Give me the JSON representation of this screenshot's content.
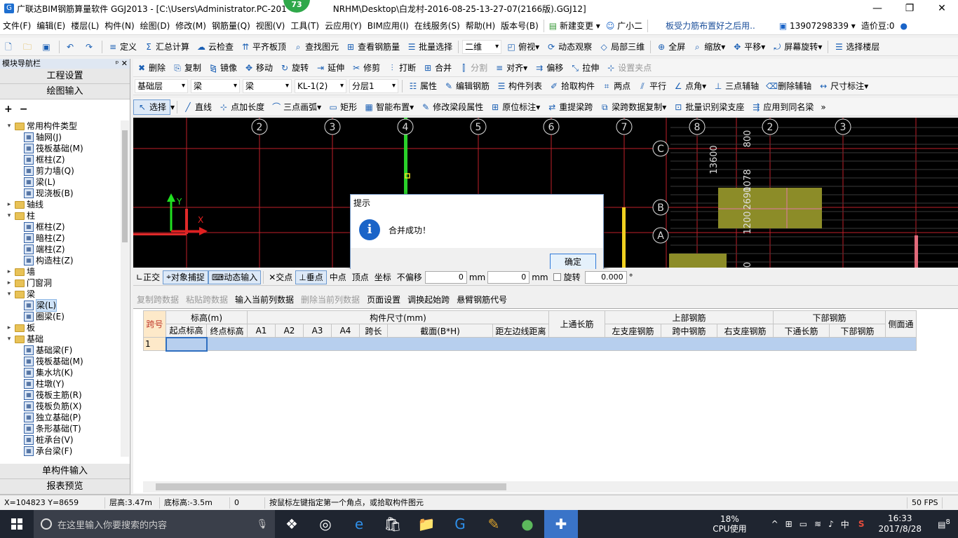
{
  "title": {
    "app": "广联达BIM钢筋算量软件 GGJ2013 - [C:\\Users\\Administrator.PC-201",
    "path": "NRHM\\Desktop\\白龙村-2016-08-25-13-27-07(2166版).GGJ12]",
    "badge": "73",
    "minimize": "—",
    "restore": "❐",
    "close": "✕"
  },
  "menu": {
    "items": [
      "文件(F)",
      "编辑(E)",
      "楼层(L)",
      "构件(N)",
      "绘图(D)",
      "修改(M)",
      "钢筋量(Q)",
      "视图(V)",
      "工具(T)",
      "云应用(Y)",
      "BIM应用(I)",
      "在线服务(S)",
      "帮助(H)",
      "版本号(B)"
    ],
    "new_change": "新建变更",
    "xiaoer": "广小二",
    "notice": "板受力筋布置好之后用..",
    "phone": "13907298339",
    "beans": "造价豆:0"
  },
  "toolbar1": {
    "items": [
      "定义",
      "汇总计算",
      "云检查",
      "平齐板顶",
      "查找图元",
      "查看钢筋量",
      "批量选择"
    ],
    "view2d": "二维",
    "view_top": "俯视",
    "dynamic": "动态观察",
    "local3d": "局部三维",
    "fullscreen": "全屏",
    "zoom": "缩放",
    "pan": "平移",
    "rotate": "屏幕旋转",
    "select_floor": "选择楼层"
  },
  "toolbar2": {
    "items": [
      "删除",
      "复制",
      "镜像",
      "移动",
      "旋转",
      "延伸",
      "修剪",
      "打断",
      "合并",
      "分割",
      "对齐",
      "偏移",
      "拉伸",
      "设置夹点"
    ]
  },
  "toolbar3": {
    "floor": "基础层",
    "type1": "梁",
    "type2": "梁",
    "component": "KL-1(2)",
    "layer": "分层1",
    "items": [
      "属性",
      "编辑钢筋",
      "构件列表",
      "拾取构件",
      "两点",
      "平行",
      "点角",
      "三点辅轴",
      "删除辅轴",
      "尺寸标注"
    ]
  },
  "toolbar4": {
    "select": "选择",
    "items": [
      "直线",
      "点加长度",
      "三点画弧",
      "矩形",
      "智能布置",
      "修改梁段属性",
      "原位标注",
      "重提梁跨",
      "梁跨数据复制",
      "批量识别梁支座",
      "应用到同名梁"
    ]
  },
  "leftpanel": {
    "title": "模块导航栏",
    "pin": "ᵖ",
    "close": "✕",
    "project_settings": "工程设置",
    "draw_input": "绘图输入",
    "single_input": "单构件输入",
    "report": "报表预览",
    "tree": [
      {
        "level": 0,
        "exp": "▾",
        "folder": true,
        "label": "常用构件类型"
      },
      {
        "level": 1,
        "label": "轴网(J)"
      },
      {
        "level": 1,
        "label": "筏板基础(M)"
      },
      {
        "level": 1,
        "label": "框柱(Z)"
      },
      {
        "level": 1,
        "label": "剪力墙(Q)"
      },
      {
        "level": 1,
        "label": "梁(L)"
      },
      {
        "level": 1,
        "label": "现浇板(B)"
      },
      {
        "level": 0,
        "exp": "▸",
        "folder": true,
        "label": "轴线"
      },
      {
        "level": 0,
        "exp": "▾",
        "folder": true,
        "label": "柱"
      },
      {
        "level": 1,
        "label": "框柱(Z)"
      },
      {
        "level": 1,
        "label": "暗柱(Z)"
      },
      {
        "level": 1,
        "label": "端柱(Z)"
      },
      {
        "level": 1,
        "label": "构造柱(Z)"
      },
      {
        "level": 0,
        "exp": "▸",
        "folder": true,
        "label": "墙"
      },
      {
        "level": 0,
        "exp": "▸",
        "folder": true,
        "label": "门窗洞"
      },
      {
        "level": 0,
        "exp": "▾",
        "folder": true,
        "label": "梁"
      },
      {
        "level": 1,
        "label": "梁(L)",
        "selected": true
      },
      {
        "level": 1,
        "label": "圈梁(E)"
      },
      {
        "level": 0,
        "exp": "▸",
        "folder": true,
        "label": "板"
      },
      {
        "level": 0,
        "exp": "▾",
        "folder": true,
        "label": "基础"
      },
      {
        "level": 1,
        "label": "基础梁(F)"
      },
      {
        "level": 1,
        "label": "筏板基础(M)"
      },
      {
        "level": 1,
        "label": "集水坑(K)"
      },
      {
        "level": 1,
        "label": "柱墩(Y)"
      },
      {
        "level": 1,
        "label": "筏板主筋(R)"
      },
      {
        "level": 1,
        "label": "筏板负筋(X)"
      },
      {
        "level": 1,
        "label": "独立基础(P)"
      },
      {
        "level": 1,
        "label": "条形基础(T)"
      },
      {
        "level": 1,
        "label": "桩承台(V)"
      },
      {
        "level": 1,
        "label": "承台梁(F)"
      }
    ]
  },
  "canvas": {
    "axis_top": [
      "2",
      "3",
      "4",
      "5",
      "6",
      "7",
      "8",
      "2",
      "3"
    ],
    "axis_side": [
      "C",
      "B",
      "A"
    ],
    "dim_labels": [
      "13600",
      "800",
      "1078",
      "2690",
      "1200",
      "0"
    ],
    "ucs_y": "Y",
    "ucs_x": "X"
  },
  "dialog": {
    "title": "提示",
    "message": "合并成功！",
    "ok": "确定",
    "info_glyph": "i"
  },
  "snapbar": {
    "ortho": "正交",
    "snap": "对象捕捉",
    "dyn": "动态输入",
    "cross": "交点",
    "perp": "垂点",
    "mid": "中点",
    "top": "顶点",
    "coord": "坐标",
    "offset": "不偏移",
    "x_val": "0",
    "y_val": "0",
    "mm1": "mm",
    "mm2": "mm",
    "rotate": "旋转",
    "rot_val": "0.000",
    "deg": "°"
  },
  "gridtoolbar": {
    "items": [
      "复制跨数据",
      "粘贴跨数据",
      "输入当前列数据",
      "删除当前列数据",
      "页面设置",
      "调换起始跨",
      "悬臂钢筋代号"
    ]
  },
  "grid": {
    "span_no": "跨号",
    "elev": "标高(m)",
    "elev_cols": [
      "起点标高",
      "终点标高"
    ],
    "size": "构件尺寸(mm)",
    "size_cols": [
      "A1",
      "A2",
      "A3",
      "A4",
      "跨长",
      "截面(B*H)",
      "距左边线距离"
    ],
    "top_through": "上通长筋",
    "top_rebar": "上部钢筋",
    "top_cols": [
      "左支座钢筋",
      "跨中钢筋",
      "右支座钢筋"
    ],
    "bottom_rebar": "下部钢筋",
    "bottom_cols": [
      "下通长筋",
      "下部钢筋"
    ],
    "side": "侧面通",
    "row_no": "1"
  },
  "status": {
    "coords": "X=104823 Y=8659",
    "floor_h": "层高:3.47m",
    "bottom_elev": "底标高:-3.5m",
    "zero": "0",
    "hint": "按鼠标左键指定第一个角点，或拾取构件图元",
    "fps": "50 FPS"
  },
  "taskbar": {
    "search_placeholder": "在这里输入你要搜索的内容",
    "cpu_pct": "18%",
    "cpu_label": "CPU使用",
    "ime": "中",
    "time": "16:33",
    "date": "2017/8/28",
    "notif": "8"
  }
}
